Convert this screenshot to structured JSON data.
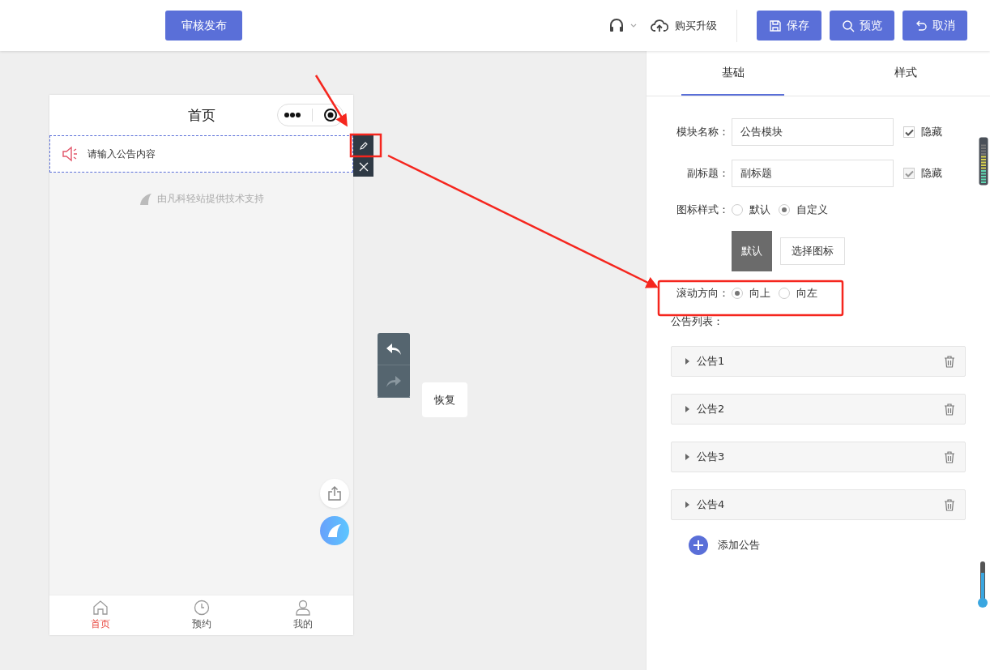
{
  "toolbar": {
    "publish": "审核发布",
    "upgrade": "购买升级",
    "buttons": [
      {
        "label": "保存",
        "kind": "save"
      },
      {
        "label": "预览",
        "kind": "preview"
      },
      {
        "label": "取消",
        "kind": "cancel"
      }
    ]
  },
  "phone": {
    "title": "首页",
    "notice_placeholder": "请输入公告内容",
    "support": "由凡科轻站提供技术支持",
    "tabs": [
      {
        "label": "首页",
        "selected": true,
        "kind": "home"
      },
      {
        "label": "预约",
        "selected": false,
        "kind": "clock"
      },
      {
        "label": "我的",
        "selected": false,
        "kind": "user"
      }
    ]
  },
  "history": {
    "undo_disabled": false,
    "redo_disabled": true,
    "tooltip": "恢复"
  },
  "panel": {
    "tabs": [
      {
        "label": "基础",
        "selected": true
      },
      {
        "label": "样式",
        "selected": false
      }
    ],
    "fields": [
      {
        "label": "模块名称：",
        "value": "公告模块",
        "hide_label": "隐藏",
        "checked": true,
        "disabled": false
      },
      {
        "label": "副标题：",
        "value": "副标题",
        "hide_label": "隐藏",
        "checked": true,
        "disabled": true
      }
    ],
    "icon_style": {
      "label": "图标样式：",
      "options": [
        {
          "label": "默认",
          "selected": false
        },
        {
          "label": "自定义",
          "selected": true
        }
      ],
      "preview": "默认",
      "choose": "选择图标"
    },
    "scroll": {
      "label": "滚动方向：",
      "options": [
        {
          "label": "向上",
          "selected": true
        },
        {
          "label": "向左",
          "selected": false
        }
      ]
    },
    "list_label": "公告列表：",
    "notices": [
      {
        "title": "公告1"
      },
      {
        "title": "公告2"
      },
      {
        "title": "公告3"
      },
      {
        "title": "公告4"
      }
    ],
    "add": "添加公告"
  }
}
